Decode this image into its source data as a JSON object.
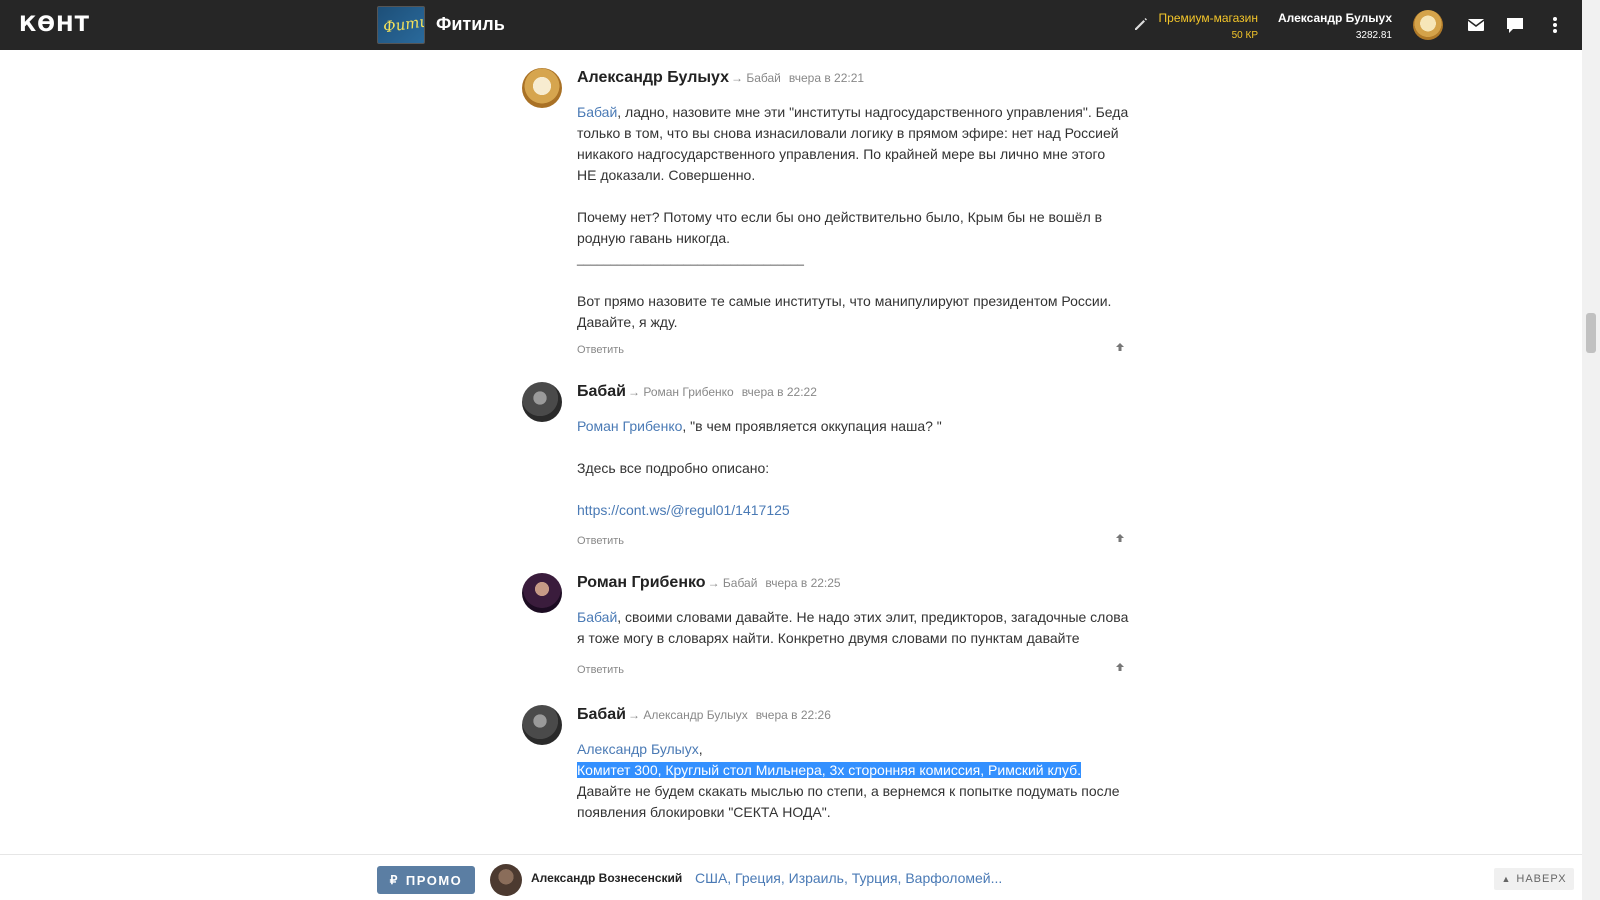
{
  "topbar": {
    "logo": "КѲНТ",
    "group_title": "Фитиль",
    "group_avatar_text": "Фитиль",
    "premium_label": "Премиум-магазин",
    "premium_kp": "50 КР",
    "user_name": "Александр Булыух",
    "user_score": "3282.81",
    "icons": [
      "pencil-icon",
      "mail-icon",
      "chat-icon",
      "more-icon"
    ]
  },
  "comments": [
    {
      "author": "Александр Булыух",
      "to": "→ Бабай",
      "time": "вчера в 22:21",
      "mention": "Бабай",
      "lines": [
        ", ладно, назовите мне эти \"институты надгосударственного управления\". Беда",
        "только в том, что вы снова изнасиловали логику в прямом эфире: нет над Россией",
        "никакого надгосударственного управления. По крайней мере вы лично мне этого",
        "НЕ доказали. Совершенно.",
        "",
        "Почему нет? Потому что если бы оно действительно было, Крым бы не вошёл в",
        "родную гавань никогда.",
        "__________________________________",
        "",
        "Вот прямо назовите те самые институты, что манипулируют президентом России.",
        "Давайте, я жду."
      ],
      "reply": "Ответить"
    },
    {
      "author": "Бабай",
      "to": "→ Роман Грибенко",
      "time": "вчера в 22:22",
      "mention": "Роман Грибенко",
      "lines": [
        ", \"в чем проявляется оккупация наша? \"",
        "",
        "Здесь все подробно описано:",
        ""
      ],
      "link": "https://cont.ws/@regul01/1417125",
      "reply": "Ответить"
    },
    {
      "author": "Роман Грибенко",
      "to": "→ Бабай",
      "time": "вчера в 22:25",
      "mention": "Бабай",
      "lines": [
        ", своими словами давайте. Не надо этих элит, предикторов, загадочные слова",
        "я тоже могу в словарях найти. Конкретно двумя словами по пунктам давайте"
      ],
      "reply": "Ответить"
    },
    {
      "author": "Бабай",
      "to": "→ Александр Булыух",
      "time": "вчера в 22:26",
      "mention": "Александр Булыух",
      "after_mention": ",",
      "selected": "Комитет 300, Круглый стол Мильнера, 3х сторонняя комиссия, Римский клуб.",
      "lines": [
        "Давайте не будем скакать мыслью по степи, а вернемся к попытке подумать после",
        "появления блокировки \"СЕКТА НОДА\"."
      ]
    }
  ],
  "bottombar": {
    "promo_symbol": "₽",
    "promo_label": "ПРОМО",
    "author": "Александр Вознесенский",
    "title": "США, Греция, Израиль, Турция, Варфоломей...",
    "to_top": "НАВЕРХ",
    "to_top_symbol": "▲"
  }
}
